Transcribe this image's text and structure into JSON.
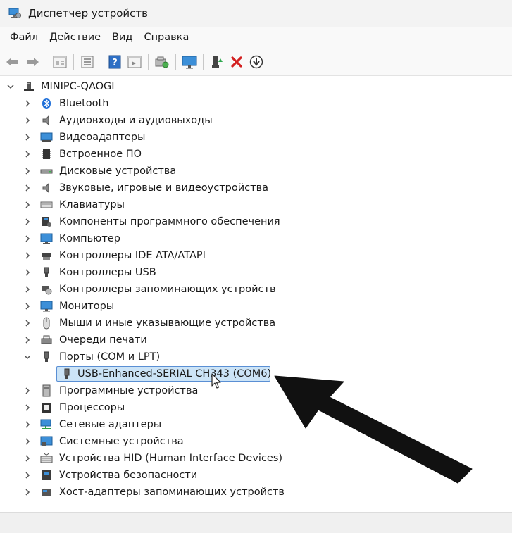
{
  "window": {
    "title": "Диспетчер устройств"
  },
  "menu": [
    "Файл",
    "Действие",
    "Вид",
    "Справка"
  ],
  "toolbar": {
    "buttons": [
      "back-arrow-icon",
      "forward-arrow-icon",
      "properties-icon",
      "list-icon",
      "help-icon",
      "view-icon",
      "scan-icon",
      "monitor-icon",
      "enable-device-icon",
      "uninstall-x-icon",
      "update-driver-icon"
    ],
    "accent_red": "#d32020"
  },
  "tree": {
    "root": "MINIPC-QAOGI",
    "categories": [
      "Bluetooth",
      "Аудиовходы и аудиовыходы",
      "Видеоадаптеры",
      "Встроенное ПО",
      "Дисковые устройства",
      "Звуковые, игровые и видеоустройства",
      "Клавиатуры",
      "Компоненты программного обеспечения",
      "Компьютер",
      "Контроллеры IDE ATA/ATAPI",
      "Контроллеры USB",
      "Контроллеры запоминающих устройств",
      "Мониторы",
      "Мыши и иные указывающие устройства",
      "Очереди печати",
      "Порты (COM и LPT)",
      "Программные устройства",
      "Процессоры",
      "Сетевые адаптеры",
      "Системные устройства",
      "Устройства HID (Human Interface Devices)",
      "Устройства безопасности",
      "Хост-адаптеры запоминающих устройств"
    ],
    "expanded_index": 15,
    "expanded_child": "USB-Enhanced-SERIAL CH343 (COM6)",
    "icons": [
      "bluetooth-icon",
      "speaker-icon",
      "display-adapter-icon",
      "firmware-icon",
      "disk-drive-icon",
      "sound-icon",
      "keyboard-icon",
      "software-component-icon",
      "computer-icon",
      "ide-controller-icon",
      "usb-controller-icon",
      "storage-controller-icon",
      "monitor-icon",
      "mouse-icon",
      "print-queue-icon",
      "port-icon",
      "software-device-icon",
      "processor-icon",
      "network-adapter-icon",
      "system-device-icon",
      "hid-icon",
      "security-device-icon",
      "storage-host-adapter-icon"
    ]
  },
  "colors": {
    "selection_bg": "#cce4f7",
    "selection_border": "#5a8fd4",
    "bluetooth": "#1e6fd9"
  }
}
